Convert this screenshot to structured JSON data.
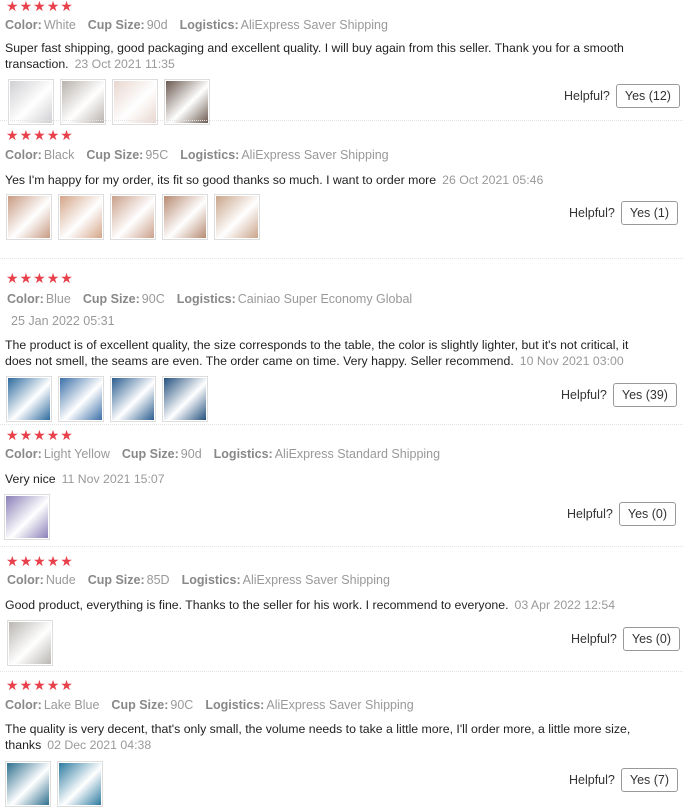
{
  "reviews": [
    {
      "stars": 5,
      "meta": [
        {
          "label": "Color:",
          "value": "White"
        },
        {
          "label": "Cup Size:",
          "value": "90d"
        },
        {
          "label": "Logistics:",
          "value": "AliExpress Saver Shipping"
        }
      ],
      "text": "Super fast shipping, good packaging and excellent quality. I will buy again from this seller. Thank you for a smooth transaction.",
      "date": "23 Oct 2021 11:35",
      "extra_date": "",
      "helpful_label": "Helpful?",
      "yes_label": "Yes (12)",
      "photos": [
        "#cfcfd2",
        "#b8b2ac",
        "#e8d6cf",
        "#6b5a50"
      ]
    },
    {
      "stars": 5,
      "meta": [
        {
          "label": "Color:",
          "value": "Black"
        },
        {
          "label": "Cup Size:",
          "value": "95C"
        },
        {
          "label": "Logistics:",
          "value": "AliExpress Saver Shipping"
        }
      ],
      "text": "Yes I'm happy for my order, its fit so good thanks so much. I want to order more",
      "date": "26 Oct 2021 05:46",
      "extra_date": "",
      "helpful_label": "Helpful?",
      "yes_label": "Yes (1)",
      "photos": [
        "#c89a82",
        "#d4a588",
        "#caa08a",
        "#b78a72",
        "#c9a48a"
      ]
    },
    {
      "stars": 5,
      "meta": [
        {
          "label": "Color:",
          "value": "Blue"
        },
        {
          "label": "Cup Size:",
          "value": "90C"
        },
        {
          "label": "Logistics:",
          "value": "Cainiao Super Economy Global"
        }
      ],
      "text": "The product is of excellent quality, the size corresponds to the table, the color is slightly lighter, but it's not critical, it does not smell, the seams are even. The order came on time. Very happy. Seller recommend.",
      "date": "10 Nov 2021 03:00",
      "extra_date": "25 Jan 2022 05:31",
      "helpful_label": "Helpful?",
      "yes_label": "Yes (39)",
      "photos": [
        "#2d6a9e",
        "#3b6fa8",
        "#2a5d8f",
        "#24517e"
      ]
    },
    {
      "stars": 5,
      "meta": [
        {
          "label": "Color:",
          "value": "Light Yellow"
        },
        {
          "label": "Cup Size:",
          "value": "90d"
        },
        {
          "label": "Logistics:",
          "value": "AliExpress Standard Shipping"
        }
      ],
      "text": "Very nice",
      "date": "11 Nov 2021 15:07",
      "extra_date": "",
      "helpful_label": "Helpful?",
      "yes_label": "Yes (0)",
      "photos": [
        "#8a7fb8"
      ]
    },
    {
      "stars": 5,
      "meta": [
        {
          "label": "Color:",
          "value": "Nude"
        },
        {
          "label": "Cup Size:",
          "value": "85D"
        },
        {
          "label": "Logistics:",
          "value": "AliExpress Saver Shipping"
        }
      ],
      "text": "Good product, everything is fine. Thanks to the seller for his work. I recommend to everyone.",
      "date": "03 Apr 2022 12:54",
      "extra_date": "",
      "helpful_label": "Helpful?",
      "yes_label": "Yes (0)",
      "photos": [
        "#b9b6b2"
      ]
    },
    {
      "stars": 5,
      "meta": [
        {
          "label": "Color:",
          "value": "Lake Blue"
        },
        {
          "label": "Cup Size:",
          "value": "90C"
        },
        {
          "label": "Logistics:",
          "value": "AliExpress Saver Shipping"
        }
      ],
      "text": "The quality is very decent, that's only small, the volume needs to take a little more, I'll order more, a little more size, thanks",
      "date": "02 Dec 2021 04:38",
      "extra_date": "",
      "helpful_label": "Helpful?",
      "yes_label": "Yes (7)",
      "photos": [
        "#2e6f8e",
        "#2c7aa0"
      ]
    }
  ]
}
